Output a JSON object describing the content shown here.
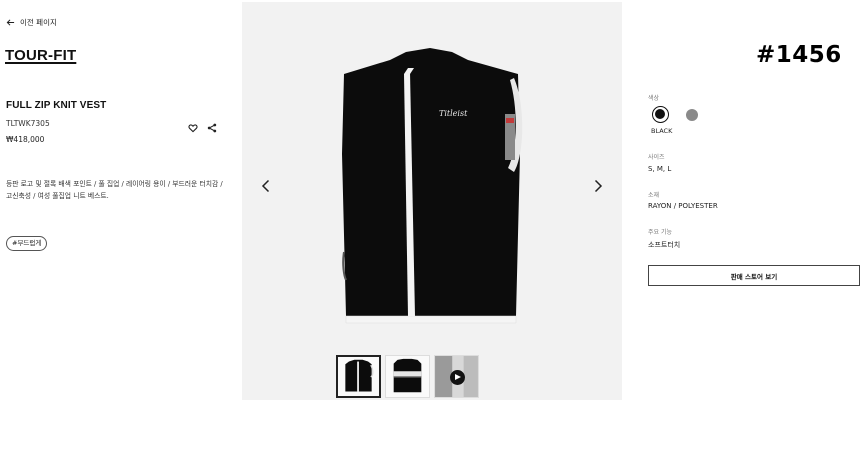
{
  "nav": {
    "back_label": "이전 페이지"
  },
  "product": {
    "brand": "TOUR-FIT",
    "name": "FULL ZIP KNIT VEST",
    "sku": "TLTWK7305",
    "price": "₩418,000",
    "description": "등판 로고 및 절록 배색 포인트 / 풀 집업 / 레이어링 용이 / 부드러운 터치감 / 고신축성 / 여성 풀집업 니트 베스트.",
    "tag": "#부드럽게",
    "chest_logo": "Titleist"
  },
  "watermark": "#1456",
  "options": {
    "color_label": "색상",
    "colors": [
      {
        "name": "BLACK",
        "hex": "#111111",
        "selected": true
      },
      {
        "name": "",
        "hex": "#8a8a8a",
        "selected": false
      }
    ],
    "size_label": "사이즈",
    "size_value": "S, M, L",
    "material_label": "소재",
    "material_value": "RAYON / POLYESTER",
    "feature_label": "주요 기능",
    "feature_value": "소프트터치"
  },
  "store_button": "판매 스토어 보기",
  "icons": [
    "arrow-left-icon",
    "heart-icon",
    "share-icon",
    "chevron-left-icon",
    "chevron-right-icon",
    "play-icon"
  ]
}
